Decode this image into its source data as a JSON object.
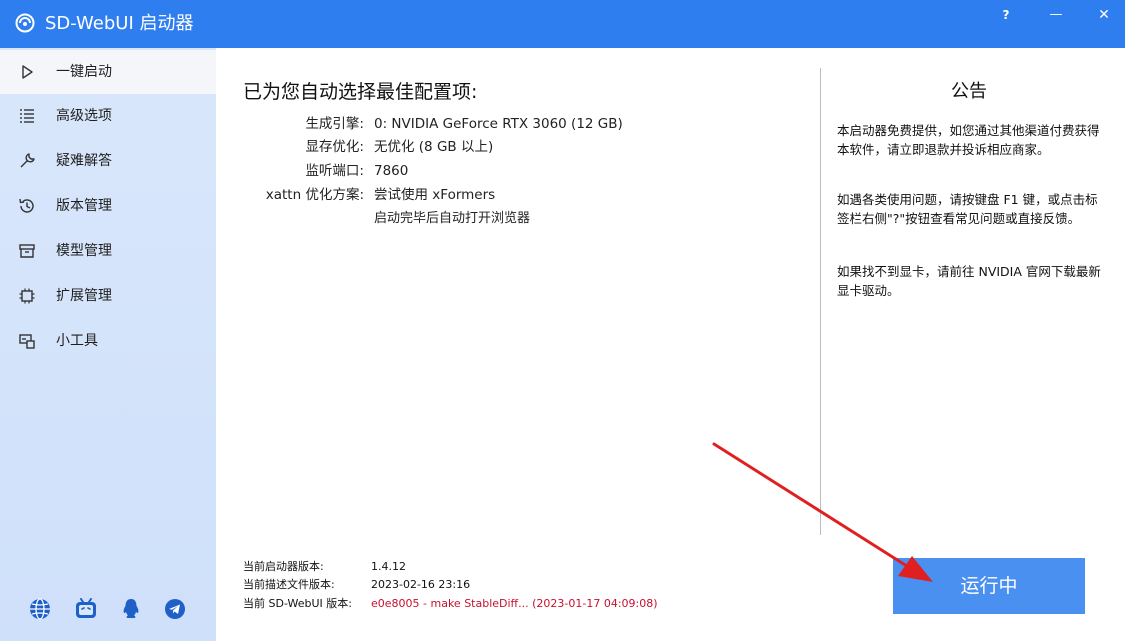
{
  "window": {
    "title": "SD-WebUI 启动器",
    "help_label": "?",
    "minimize_label": "—",
    "close_label": "✕"
  },
  "sidebar": {
    "items": [
      {
        "label": "一键启动",
        "icon": "play-outline-icon",
        "active": true
      },
      {
        "label": "高级选项",
        "icon": "list-icon"
      },
      {
        "label": "疑难解答",
        "icon": "wrench-icon"
      },
      {
        "label": "版本管理",
        "icon": "history-icon"
      },
      {
        "label": "模型管理",
        "icon": "archive-box-icon"
      },
      {
        "label": "扩展管理",
        "icon": "chip-icon"
      },
      {
        "label": "小工具",
        "icon": "toolbox-icon"
      }
    ],
    "social": [
      "globe-icon",
      "bilibili-icon",
      "qq-icon",
      "telegram-icon"
    ]
  },
  "config": {
    "heading": "已为您自动选择最佳配置项:",
    "rows": [
      {
        "label": "生成引擎:",
        "value": "0: NVIDIA GeForce RTX 3060 (12 GB)"
      },
      {
        "label": "显存优化:",
        "value": "无优化 (8 GB 以上)"
      },
      {
        "label": "监听端口:",
        "value": "7860"
      },
      {
        "label": "xattn 优化方案:",
        "value": "尝试使用 xFormers"
      }
    ],
    "extra": "启动完毕后自动打开浏览器"
  },
  "notice": {
    "title": "公告",
    "paragraphs": [
      "本启动器免费提供，如您通过其他渠道付费获得本软件，请立即退款并投诉相应商家。",
      "如遇各类使用问题，请按键盘 F1 键，或点击标签栏右侧\"?\"按钮查看常见问题或直接反馈。",
      "如果找不到显卡，请前往 NVIDIA 官网下载最新显卡驱动。"
    ]
  },
  "versions": {
    "launcher_label": "当前启动器版本:",
    "launcher_value": "1.4.12",
    "desc_label": "当前描述文件版本:",
    "desc_value": "2023-02-16 23:16",
    "webui_label": "当前 SD-WebUI 版本:",
    "webui_value": "e0e8005 - make StableDiff... (2023-01-17 04:09:08)"
  },
  "run_button": {
    "label": "运行中"
  },
  "colors": {
    "titlebar": "#2f7ef0",
    "sidebar": "#d9e7fb",
    "run_button": "#4a90f0",
    "arrow": "#e02020",
    "version_highlight": "#c8102e"
  }
}
